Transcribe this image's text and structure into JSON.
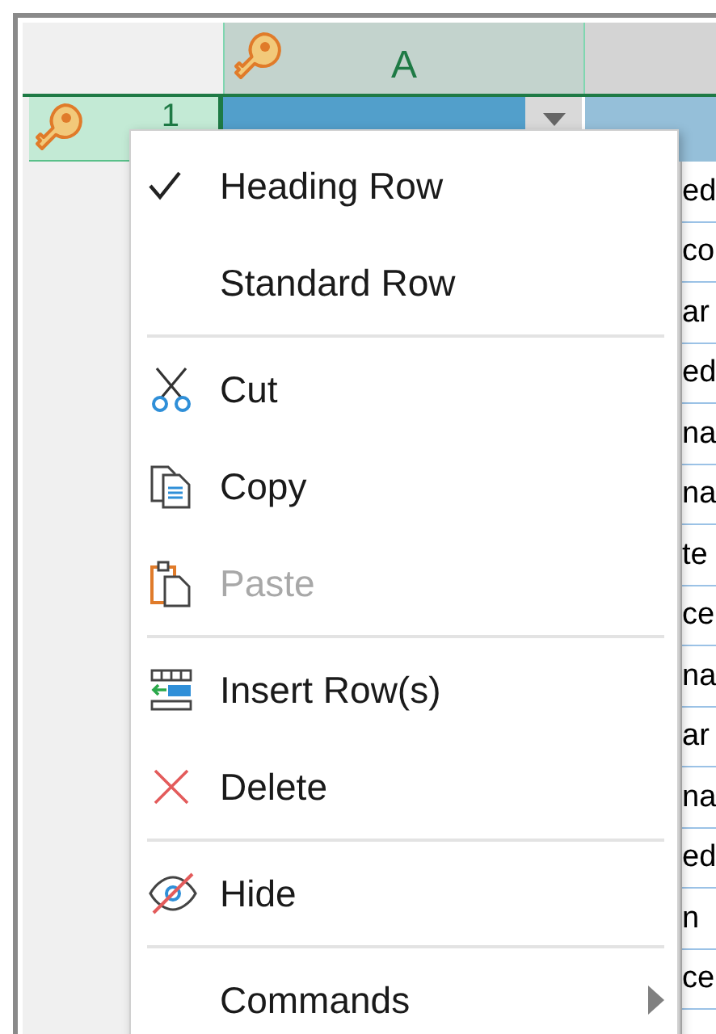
{
  "grid": {
    "column_header": {
      "label": "A",
      "key": true
    },
    "row_header": {
      "label": "1",
      "key": true
    },
    "column_2_cells": [
      "ed",
      "co",
      "ar",
      "ed",
      "na",
      "na",
      "te",
      "ce",
      "na",
      "ar",
      "na",
      "ed",
      "n",
      "ce"
    ]
  },
  "context_menu": {
    "groups": [
      [
        {
          "label": "Heading Row",
          "checked": true,
          "disabled": false,
          "submenu": false
        },
        {
          "label": "Standard Row",
          "checked": false,
          "disabled": false,
          "submenu": false
        }
      ],
      [
        {
          "label": "Cut",
          "checked": false,
          "disabled": false,
          "submenu": false
        },
        {
          "label": "Copy",
          "checked": false,
          "disabled": false,
          "submenu": false
        },
        {
          "label": "Paste",
          "checked": false,
          "disabled": true,
          "submenu": false
        }
      ],
      [
        {
          "label": "Insert Row(s)",
          "checked": false,
          "disabled": false,
          "submenu": false
        },
        {
          "label": "Delete",
          "checked": false,
          "disabled": false,
          "submenu": false
        }
      ],
      [
        {
          "label": "Hide",
          "checked": false,
          "disabled": false,
          "submenu": false
        }
      ],
      [
        {
          "label": "Commands",
          "checked": false,
          "disabled": false,
          "submenu": true
        }
      ]
    ]
  }
}
